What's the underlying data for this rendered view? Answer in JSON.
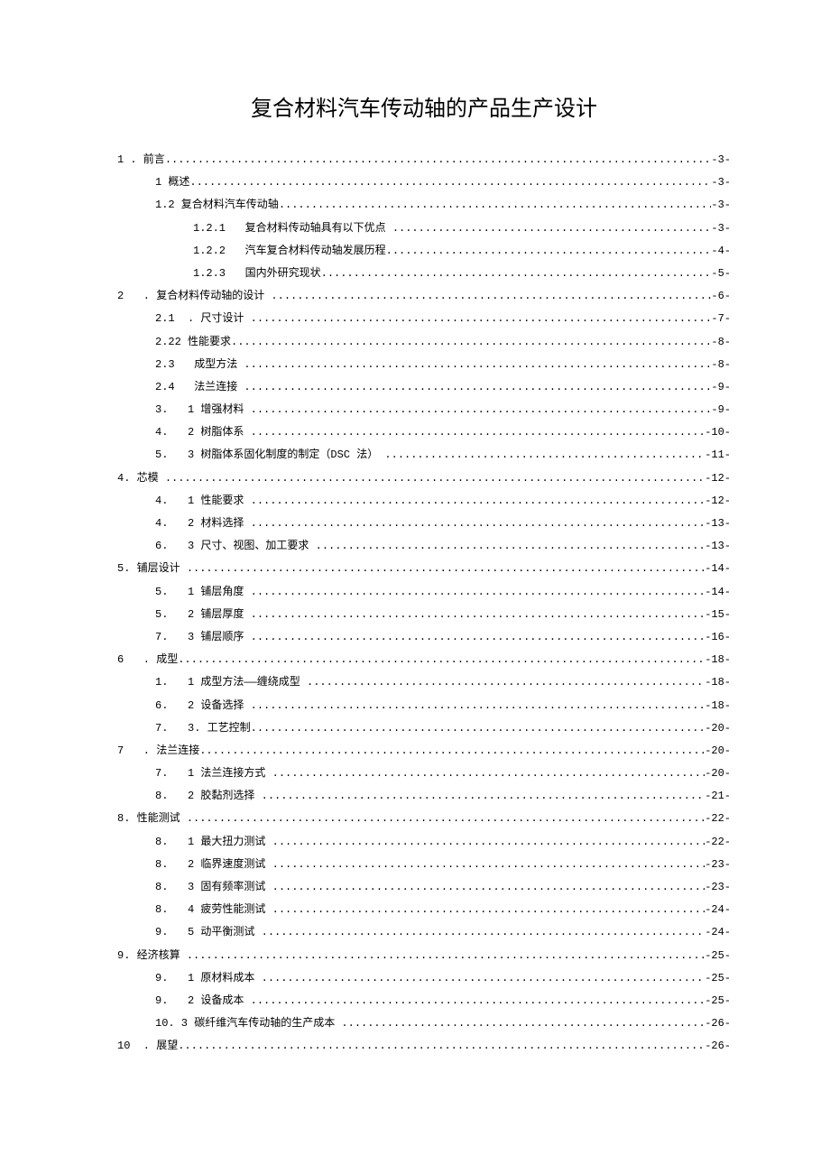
{
  "title": "复合材料汽车传动轴的产品生产设计",
  "toc": [
    {
      "indent": 0,
      "label": "1 . 前言",
      "page": "-3-"
    },
    {
      "indent": 1,
      "label": "1 概述",
      "page": "-3-"
    },
    {
      "indent": 1,
      "label": "1.2 复合材料汽车传动轴",
      "page": "-3-"
    },
    {
      "indent": 2,
      "label": "1.2.1   复合材料传动轴具有以下优点 ",
      "page": "-3-"
    },
    {
      "indent": 2,
      "label": "1.2.2   汽车复合材料传动轴发展历程",
      "page": "-4-"
    },
    {
      "indent": 2,
      "label": "1.2.3   国内外研究现状",
      "page": "-5-"
    },
    {
      "indent": 0,
      "label": "2   . 复合材料传动轴的设计 ",
      "page": "-6-"
    },
    {
      "indent": 1,
      "label": "2.1  . 尺寸设计 ",
      "page": "-7-"
    },
    {
      "indent": 1,
      "label": "2.22 性能要求",
      "page": "-8-"
    },
    {
      "indent": 1,
      "label": "2.3   成型方法 ",
      "page": "-8-"
    },
    {
      "indent": 1,
      "label": "2.4   法兰连接 ",
      "page": "-9-"
    },
    {
      "indent": 1,
      "label": "3.   1 增强材料 ",
      "page": "-9-"
    },
    {
      "indent": 1,
      "label": "4.   2 树脂体系 ",
      "page": "-10-"
    },
    {
      "indent": 1,
      "label": "5.   3 树脂体系固化制度的制定（DSC 法） ",
      "page": "-11-"
    },
    {
      "indent": 0,
      "label": "4. 芯模 ",
      "page": "-12-"
    },
    {
      "indent": 1,
      "label": "4.   1 性能要求 ",
      "page": "-12-"
    },
    {
      "indent": 1,
      "label": "4.   2 材料选择 ",
      "page": "-13-"
    },
    {
      "indent": 1,
      "label": "6.   3 尺寸、视图、加工要求 ",
      "page": "-13-"
    },
    {
      "indent": 0,
      "label": "5. 铺层设计 ",
      "page": "-14-"
    },
    {
      "indent": 1,
      "label": "5.   1 铺层角度 ",
      "page": "-14-"
    },
    {
      "indent": 1,
      "label": "5.   2 铺层厚度 ",
      "page": "-15-"
    },
    {
      "indent": 1,
      "label": "7.   3 铺层顺序 ",
      "page": "-16-"
    },
    {
      "indent": 0,
      "label": "6   . 成型",
      "page": "-18-"
    },
    {
      "indent": 1,
      "label": "1.   1 成型方法――缠绕成型 ",
      "page": "-18-"
    },
    {
      "indent": 1,
      "label": "6.   2 设备选择 ",
      "page": "-18-"
    },
    {
      "indent": 1,
      "label": "7.   3. 工艺控制",
      "page": "-20-"
    },
    {
      "indent": 0,
      "label": "7   . 法兰连接",
      "page": "-20-"
    },
    {
      "indent": 1,
      "label": "7.   1 法兰连接方式 ",
      "page": "-20-"
    },
    {
      "indent": 1,
      "label": "8.   2 胶黏剂选择 ",
      "page": "-21-"
    },
    {
      "indent": 0,
      "label": "8. 性能测试 ",
      "page": "-22-"
    },
    {
      "indent": 1,
      "label": "8.   1 最大扭力测试 ",
      "page": "-22-"
    },
    {
      "indent": 1,
      "label": "8.   2 临界速度测试 ",
      "page": "-23-"
    },
    {
      "indent": 1,
      "label": "8.   3 固有频率测试 ",
      "page": "-23-"
    },
    {
      "indent": 1,
      "label": "8.   4 疲劳性能测试 ",
      "page": "-24-"
    },
    {
      "indent": 1,
      "label": "9.   5 动平衡测试 ",
      "page": "-24-"
    },
    {
      "indent": 0,
      "label": "9. 经济核算 ",
      "page": "-25-"
    },
    {
      "indent": 1,
      "label": "9.   1 原材料成本 ",
      "page": "-25-"
    },
    {
      "indent": 1,
      "label": "9.   2 设备成本 ",
      "page": "-25-"
    },
    {
      "indent": 1,
      "label": "10. 3 碳纤维汽车传动轴的生产成本 ",
      "page": "-26-"
    },
    {
      "indent": 0,
      "label": "10  . 展望",
      "page": "-26-"
    }
  ]
}
